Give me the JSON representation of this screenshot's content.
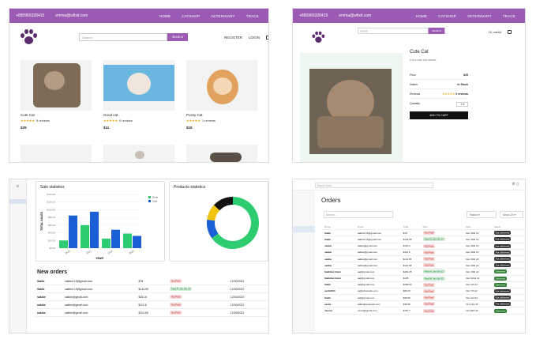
{
  "shop": {
    "phone": "+880965328415",
    "email": "emma@wfixit.com",
    "menu": [
      "HOME",
      "CATSHOP",
      "VETERINARY",
      "TRACK"
    ],
    "search_placeholder": "Search",
    "search_button": "SEARCH",
    "register": "REGISTER",
    "login": "LOGIN",
    "cart_count": "0",
    "products": [
      {
        "name": "Cute Cat",
        "stars": "★★★★★",
        "reviews": "0 reviews",
        "price": "$25"
      },
      {
        "name": "Good cat",
        "stars": "★★★★★",
        "reviews": "0 reviews",
        "price": "$11"
      },
      {
        "name": "Pussy Cat",
        "stars": "★★★★★",
        "reviews": "1 reviews",
        "price": "$15"
      }
    ]
  },
  "detail": {
    "phone": "+880965328415",
    "email": "emma@wfixit.com",
    "menu": [
      "HOME",
      "CATSHOP",
      "VETERINARY",
      "TRACK"
    ],
    "search_placeholder": "Search",
    "search_button": "SEARCH",
    "user": "Hi, sackit",
    "title": "Cute Cat",
    "subtitle": "It is a cute cat named",
    "rows": [
      {
        "label": "Price",
        "value": "$25"
      },
      {
        "label": "Status",
        "value": "In Stock"
      },
      {
        "label": "Reviews",
        "value": "0 reviews"
      },
      {
        "label": "Quantity",
        "value": "1"
      }
    ],
    "add_to_cart": "ADD TO CART"
  },
  "dashboard": {
    "sale_title": "Sale statistics",
    "products_title": "Products statistics",
    "new_orders_title": "New orders",
    "orders": [
      {
        "name": "Sakib",
        "email": "sakibul.15@gmail.com",
        "amount": "$78",
        "status": "Not Paid",
        "date": "12/30/2022"
      },
      {
        "name": "Sakib",
        "email": "sakibul.15@gmail.com",
        "amount": "$144.55",
        "status": "Paid At Jan 6th 22",
        "date": "12/30/2022"
      },
      {
        "name": "sakkie",
        "email": "sakkie@gmail.com",
        "amount": "$151.6",
        "status": "Not Paid",
        "date": "12/30/2022"
      },
      {
        "name": "sakkie",
        "email": "sakkie@gmail.com",
        "amount": "$112.6",
        "status": "Not Paid",
        "date": "12/30/2022"
      },
      {
        "name": "sakkie",
        "email": "sakkie@gmail.com",
        "amount": "$114.55",
        "status": "Not Paid",
        "date": "12/26/2022"
      }
    ]
  },
  "chart_data": [
    {
      "type": "bar",
      "title": "Sale statistics",
      "xlabel": "YEAR",
      "ylabel": "TOTAL SALES",
      "categories": [
        "2020",
        "2021",
        "2022",
        "2023"
      ],
      "series": [
        {
          "name": "Done",
          "values": [
            20,
            60,
            25,
            38
          ]
        },
        {
          "name": "Sold",
          "values": [
            85,
            95,
            48,
            32
          ]
        }
      ],
      "ylim": [
        0,
        140
      ],
      "legend": "right"
    },
    {
      "type": "pie",
      "title": "Products statistics",
      "slices": [
        {
          "label": "Sold",
          "value": 65
        },
        {
          "label": "In stock",
          "value": 12
        },
        {
          "label": "Pending",
          "value": 10
        },
        {
          "label": "Other",
          "value": 13
        }
      ]
    }
  ],
  "orders_page": {
    "title": "Orders",
    "search_placeholder": "Search...",
    "top_search": "Search term",
    "filter_status": "Status",
    "filter_show": "Show 20",
    "headers": [
      "Name",
      "Email",
      "Total",
      "Paid",
      "Date",
      "Status"
    ],
    "rows": [
      [
        "Sakib",
        "sakibul.15@gmail.com",
        "$78",
        "Not Paid",
        "Dec 30th 22",
        "Not delivered"
      ],
      [
        "Sakib",
        "sakibul.15@gmail.com",
        "$144.55",
        "Paid At Jan 6th 22",
        "Dec 30th 22",
        "Not delivered"
      ],
      [
        "sakkie",
        "sakkie@gmail.com",
        "$151.6",
        "Not Paid",
        "Dec 30th 22",
        "Not delivered"
      ],
      [
        "sakkie",
        "sakkie@gmail.com",
        "$112.6",
        "Not Paid",
        "Dec 30th 22",
        "Not delivered"
      ],
      [
        "sakkie",
        "sakkie@gmail.com",
        "$114.55",
        "Not Paid",
        "Dec 26th 22",
        "Not delivered"
      ],
      [
        "sakkie",
        "sakkie@gmail.com",
        "$114.58",
        "Not Paid",
        "Dec 26th 22",
        "Not delivered"
      ],
      [
        "Sakkibul Islam",
        "sak@gmail.com",
        "$493.25",
        "Paid At Jan 6th 22",
        "Nov 15th 22",
        "Delivered"
      ],
      [
        "Sakkibul Islam",
        "sak@gmail.com",
        "$135",
        "Paid At Jan 6th 22",
        "Nov 02nd 22",
        "Delivered"
      ],
      [
        "Sakib",
        "sak@gmail.com",
        "$380.60",
        "Not Paid",
        "Nov 4th 22",
        "Delivered"
      ],
      [
        "sackit303",
        "sa@wbaresite.com",
        "$80.15",
        "Not Paid",
        "Nov 7th 22",
        "Not delivered"
      ],
      [
        "Sakib",
        "sak@gmail.com",
        "$68.95",
        "Not Paid",
        "Nov 3rd 22",
        "Not delivered"
      ],
      [
        "sacka",
        "sakka@example.com",
        "$38.45",
        "Not Paid",
        "Oct 31st 22",
        "Not delivered"
      ],
      [
        "meowe",
        "meow@gmail.com",
        "$157.7",
        "Not Paid",
        "Oct 30th 22",
        "Delivered"
      ]
    ]
  }
}
